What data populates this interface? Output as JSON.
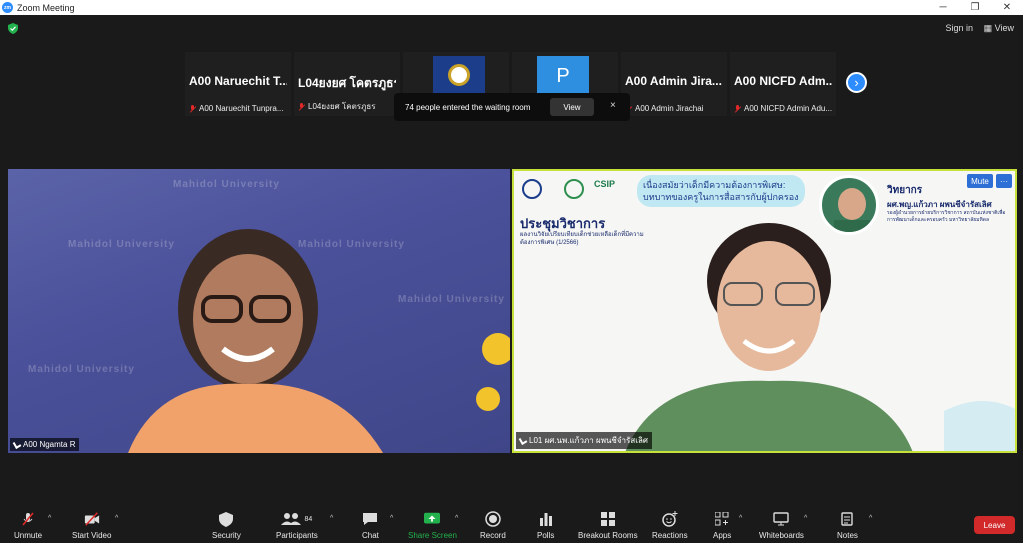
{
  "window": {
    "title": "Zoom Meeting",
    "controls": [
      "minimize-icon",
      "maximize-icon",
      "close-icon"
    ]
  },
  "topbar": {
    "sign_in": "Sign in",
    "view": "View"
  },
  "thumbnails": [
    {
      "display": "A00 Naruechit T...",
      "label": "A00 Naruechit Tunpra..."
    },
    {
      "display": "L04ยงยศ โคตรภูธร",
      "label": "L04ยงยศ โคตรภูธร"
    },
    {
      "display": "",
      "label": ""
    },
    {
      "display": "",
      "label": "Mahidol..."
    },
    {
      "display": "A00 Admin Jira...",
      "label": "A00 Admin Jirachai"
    },
    {
      "display": "A00 NICFD Adm...",
      "label": "A00 NICFD Admin Adu..."
    }
  ],
  "toast": {
    "message": "74 people entered the waiting room",
    "view": "View",
    "close": "×"
  },
  "left_video": {
    "name": "A00 Ngamta R",
    "watermarks": [
      "Mahidol University",
      "Mahidol University",
      "Mahidol University",
      "Mahidol University",
      "Mahidol University"
    ]
  },
  "right_video": {
    "name": "L01 ผศ.นพ.แก้วภา ผพนชีจำรัสเลิศ",
    "mute": "Mute",
    "more": "···",
    "slide_title": "เนื่องสมัยว่าเด็กมีความต้องการพิเศษ: บทบาทของครูในการสื่อสารกับผู้ปกครอง",
    "csip": "CSIP",
    "heading": "ประชุมวิชาการ",
    "sub": "ผลงานวิจัยเปรียบเทียบเด็กช่วยเหลือเด็กที่มีความต้องการพิเศษ (1/2566)",
    "speaker_label": "วิทยากร",
    "speaker_name": "ผศ.พญ.แก้วภา ผพนชีจำรัสเลิศ",
    "speaker_desc": "รองผู้อำนวยการฝ่ายบริการวิชาการ สถาบันแห่งชาติเพื่อการพัฒนาเด็กและครอบครัว มหาวิทยาลัยมหิดล"
  },
  "toolbar": {
    "unmute": "Unmute",
    "start_video": "Start Video",
    "security": "Security",
    "participants": "Participants",
    "participants_count": "84",
    "chat": "Chat",
    "share_screen": "Share Screen",
    "record": "Record",
    "polls": "Polls",
    "breakout_rooms": "Breakout Rooms",
    "reactions": "Reactions",
    "apps": "Apps",
    "whiteboards": "Whiteboards",
    "notes": "Notes",
    "leave": "Leave"
  },
  "colors": {
    "accent": "#2d8cff",
    "share": "#22b14c",
    "leave": "#d22a2a",
    "active_speaker": "#c6e23a"
  }
}
